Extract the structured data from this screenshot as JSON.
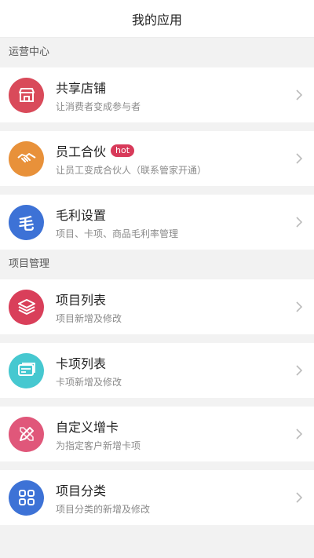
{
  "header": {
    "title": "我的应用"
  },
  "sections": [
    {
      "title": "运营中心",
      "items": [
        {
          "title": "共享店铺",
          "subtitle": "让消费者变成参与者",
          "icon": "store-icon",
          "color": "#d94a5a"
        },
        {
          "title": "员工合伙",
          "badge": "hot",
          "subtitle": "让员工变成合伙人（联系管家开通）",
          "icon": "handshake-icon",
          "color": "#e8913a"
        },
        {
          "title": "毛利设置",
          "subtitle": "项目、卡项、商品毛利率管理",
          "icon": "mao-icon",
          "icon_text": "毛",
          "color": "#3d72d6"
        }
      ]
    },
    {
      "title": "项目管理",
      "items": [
        {
          "title": "项目列表",
          "subtitle": "项目新增及修改",
          "icon": "layers-icon",
          "color": "#d93f5a"
        },
        {
          "title": "卡项列表",
          "subtitle": "卡项新增及修改",
          "icon": "card-icon",
          "color": "#46c8d0"
        },
        {
          "title": "自定义增卡",
          "subtitle": "为指定客户新增卡项",
          "icon": "pencil-ruler-icon",
          "color": "#e0577a"
        },
        {
          "title": "项目分类",
          "subtitle": "项目分类的新增及修改",
          "icon": "grid-icon",
          "color": "#3d72d6"
        }
      ]
    }
  ]
}
